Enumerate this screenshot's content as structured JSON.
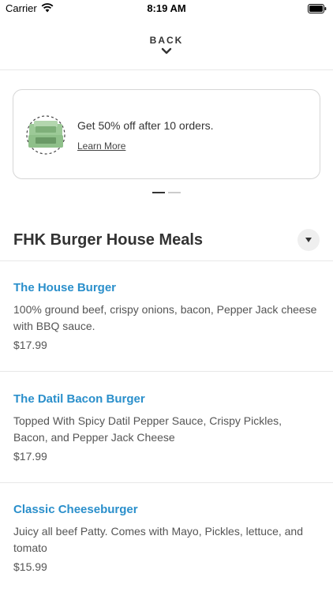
{
  "status_bar": {
    "carrier": "Carrier",
    "time": "8:19 AM"
  },
  "header": {
    "back_label": "BACK"
  },
  "promo": {
    "text": "Get 50% off after 10 orders.",
    "link": "Learn More",
    "badge_color": "#8fc08a"
  },
  "pager": {
    "count": 2,
    "active_index": 0
  },
  "section": {
    "title": "FHK Burger House Meals"
  },
  "menu_items": [
    {
      "name": "The House Burger",
      "description": "100% ground beef, crispy onions, bacon, Pepper Jack cheese with BBQ sauce.",
      "price": "$17.99"
    },
    {
      "name": "The Datil Bacon Burger",
      "description": "Topped With Spicy Datil Pepper Sauce, Crispy Pickles, Bacon, and Pepper Jack Cheese",
      "price": "$17.99"
    },
    {
      "name": "Classic Cheeseburger",
      "description": "Juicy all beef Patty. Comes with Mayo, Pickles, lettuce, and tomato",
      "price": "$15.99"
    }
  ],
  "colors": {
    "accent": "#2a8fcb",
    "text": "#333333"
  }
}
